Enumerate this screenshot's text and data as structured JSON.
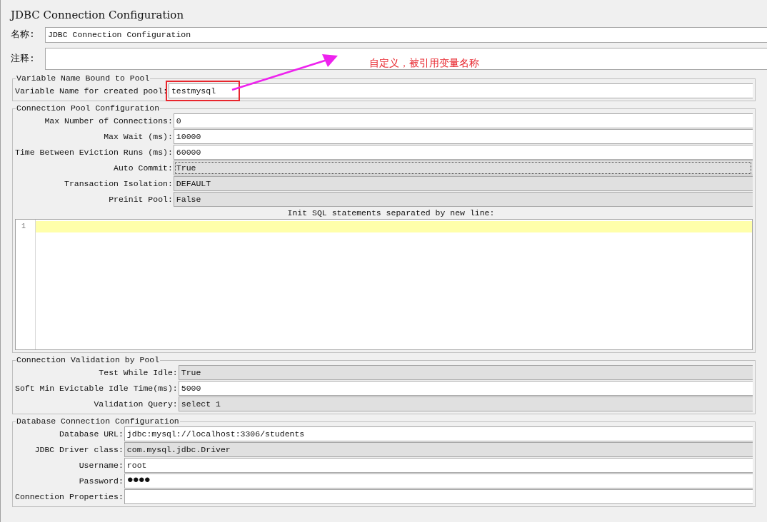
{
  "title": "JDBC Connection Configuration",
  "name_field": {
    "label": "名称:",
    "value": "JDBC Connection Configuration"
  },
  "comment_field": {
    "label": "注释:"
  },
  "groups": [
    {
      "legend": "Variable Name Bound to Pool",
      "fields": [
        {
          "label": "Variable Name for created pool:",
          "value": "testmysql",
          "kind": "text",
          "focused": false,
          "highlighted": true
        }
      ]
    },
    {
      "legend": "Connection Pool Configuration",
      "fields": [
        {
          "label": "Max Number of Connections:",
          "value": "0",
          "kind": "text",
          "focused": false
        },
        {
          "label": "Max Wait (ms):",
          "value": "10000",
          "kind": "text",
          "focused": false
        },
        {
          "label": "Time Between Eviction Runs (ms):",
          "value": "60000",
          "kind": "text",
          "focused": false
        },
        {
          "label": "Auto Commit:",
          "value": "True",
          "kind": "combo",
          "focused": true
        },
        {
          "label": "Transaction Isolation:",
          "value": "DEFAULT",
          "kind": "combo",
          "focused": false
        },
        {
          "label": "Preinit Pool:",
          "value": "False",
          "kind": "combo",
          "focused": false
        }
      ],
      "editor": {
        "caption": "Init SQL statements separated by new line:",
        "line_numbers": [
          "1"
        ]
      }
    },
    {
      "legend": "Connection Validation by Pool",
      "fields": [
        {
          "label": "Test While Idle:",
          "value": "True",
          "kind": "combo",
          "focused": false
        },
        {
          "label": "Soft Min Evictable Idle Time(ms):",
          "value": "5000",
          "kind": "text",
          "focused": false
        },
        {
          "label": "Validation Query:",
          "value": "select 1",
          "kind": "combo",
          "focused": false
        }
      ]
    },
    {
      "legend": "Database Connection Configuration",
      "fields": [
        {
          "label": "Database URL:",
          "value": "jdbc:mysql://localhost:3306/students",
          "kind": "text",
          "focused": false
        },
        {
          "label": "JDBC Driver class:",
          "value": "com.mysql.jdbc.Driver",
          "kind": "combo",
          "focused": false
        },
        {
          "label": "Username:",
          "value": "root",
          "kind": "text",
          "focused": false
        },
        {
          "label": "Password:",
          "value": "●●●●",
          "kind": "password",
          "focused": false
        },
        {
          "label": "Connection Properties:",
          "kind": "text",
          "focused": false
        }
      ]
    }
  ],
  "annotation": {
    "text": "自定义，被引用变量名称"
  }
}
